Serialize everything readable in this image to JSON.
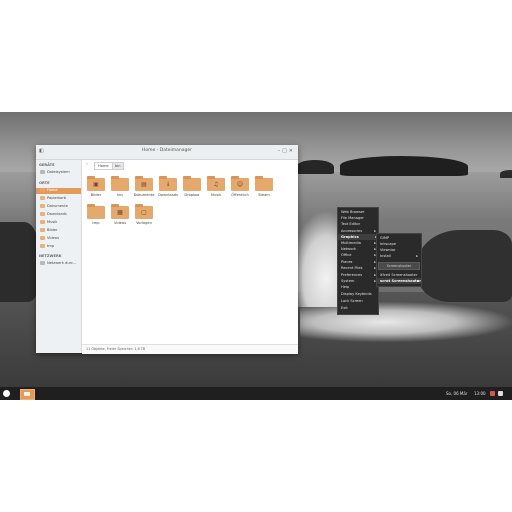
{
  "window": {
    "title": "Home - Dateimanager",
    "path_home": "Home",
    "path_current": "bin",
    "status": "11 Objekte, Freier Speicher: 1,6 TB",
    "folder_color": "#e5a86d",
    "accent": "#e39b5c"
  },
  "sidebar": {
    "section_devices": "GERÄTE",
    "devices": [
      {
        "label": "Dateisystem"
      }
    ],
    "section_places": "ORTE",
    "places": [
      {
        "label": "Home",
        "selected": true
      },
      {
        "label": "Papierkorb"
      },
      {
        "label": "Dokumente"
      },
      {
        "label": "Downloads"
      },
      {
        "label": "Musik"
      },
      {
        "label": "Bilder"
      },
      {
        "label": "Videos"
      },
      {
        "label": "tmp"
      }
    ],
    "section_network": "NETZWERK",
    "network": [
      {
        "label": "Netzwerk durc..."
      }
    ]
  },
  "folders": [
    {
      "label": "Bilder",
      "icon": "image-icon"
    },
    {
      "label": "bin",
      "icon": "folder-icon"
    },
    {
      "label": "Dokumente",
      "icon": "document-icon"
    },
    {
      "label": "Downloads",
      "icon": "download-icon"
    },
    {
      "label": "Dropbox",
      "icon": "folder-icon"
    },
    {
      "label": "Musik",
      "icon": "music-icon"
    },
    {
      "label": "Öffentlich",
      "icon": "share-icon"
    },
    {
      "label": "Steam",
      "icon": "folder-icon"
    },
    {
      "label": "tmp",
      "icon": "folder-icon"
    },
    {
      "label": "Videos",
      "icon": "video-icon"
    },
    {
      "label": "Vorlagen",
      "icon": "template-icon"
    }
  ],
  "menu": {
    "items": [
      {
        "label": "Web Browser",
        "submenu": false
      },
      {
        "label": "File Manager",
        "submenu": false
      },
      {
        "label": "Text Editor",
        "submenu": false
      },
      {
        "label": "Accessories",
        "submenu": true
      },
      {
        "label": "Graphics",
        "submenu": true,
        "selected": true
      },
      {
        "label": "Multimedia",
        "submenu": true
      },
      {
        "label": "Network",
        "submenu": true
      },
      {
        "label": "Office",
        "submenu": true
      },
      {
        "label": "Places",
        "submenu": true
      },
      {
        "label": "Recent Files",
        "submenu": true
      },
      {
        "label": "Preferences",
        "submenu": true
      },
      {
        "label": "System",
        "submenu": true
      },
      {
        "label": "Help",
        "submenu": false
      },
      {
        "label": "Display Keybinds",
        "submenu": false
      },
      {
        "label": "Lock Screen",
        "submenu": false
      },
      {
        "label": "Exit",
        "submenu": false
      }
    ],
    "submenu_items": [
      {
        "label": "GIMP",
        "submenu": false
      },
      {
        "label": "Inkscape",
        "submenu": false
      },
      {
        "label": "Viewnior",
        "submenu": false
      },
      {
        "label": "Install",
        "submenu": true
      },
      {
        "label": "Screenshooter",
        "submenu": false,
        "tooltip": true
      },
      {
        "label": "Xfce4 Screenshooter",
        "submenu": false
      },
      {
        "label": "scrot Screenshooter",
        "submenu": true,
        "highlight": true
      }
    ]
  },
  "taskbar": {
    "date": "So, 06 Mär",
    "time": "13:00"
  }
}
